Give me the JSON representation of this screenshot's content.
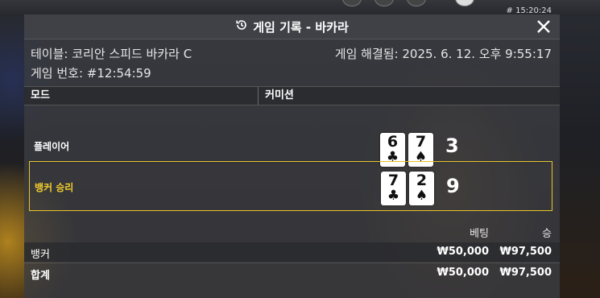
{
  "top": {
    "clock": "# 15:20:24"
  },
  "header": {
    "title": "게임 기록 - 바카라"
  },
  "info": {
    "table": "테이블: 코리안 스피드 바카라 C",
    "game_number": "게임 번호: #12:54:59",
    "resolved": "게임 해결됨: 2025. 6. 12. 오후 9:55:17"
  },
  "mode": {
    "label": "모드",
    "value": "커미션"
  },
  "player": {
    "label": "플레이어",
    "cards": [
      {
        "rank": "6",
        "suit": "♣"
      },
      {
        "rank": "7",
        "suit": "♠"
      }
    ],
    "score": "3"
  },
  "banker": {
    "label": "뱅커 승리",
    "cards": [
      {
        "rank": "7",
        "suit": "♣"
      },
      {
        "rank": "2",
        "suit": "♠"
      }
    ],
    "score": "9",
    "highlight_color": "#e7c42b"
  },
  "bets": {
    "headers": {
      "bet": "베팅",
      "win": "승"
    },
    "rows": [
      {
        "name": "뱅커",
        "bet": "₩50,000",
        "win": "₩97,500"
      },
      {
        "name": "합계",
        "bet": "₩50,000",
        "win": "₩97,500"
      }
    ]
  }
}
